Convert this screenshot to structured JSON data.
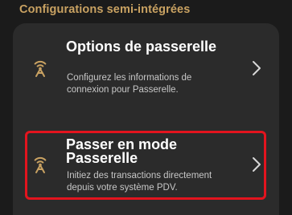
{
  "section": {
    "title": "Configurations semi-intégrées"
  },
  "items": [
    {
      "title": "Options de passerelle",
      "description": "Configurez les informations de connexion pour Passerelle.",
      "icon": "broadcast-icon",
      "chevron": "chevron-right-icon"
    },
    {
      "title": "Passer en mode Passerelle",
      "description": "Initiez des transactions directement depuis votre système PDV.",
      "icon": "broadcast-icon",
      "chevron": "chevron-right-icon",
      "highlighted": true
    }
  ],
  "colors": {
    "background": "#1b1b1b",
    "card": "#2b2b2b",
    "accent": "#c9a262",
    "highlight": "#e3141e"
  }
}
